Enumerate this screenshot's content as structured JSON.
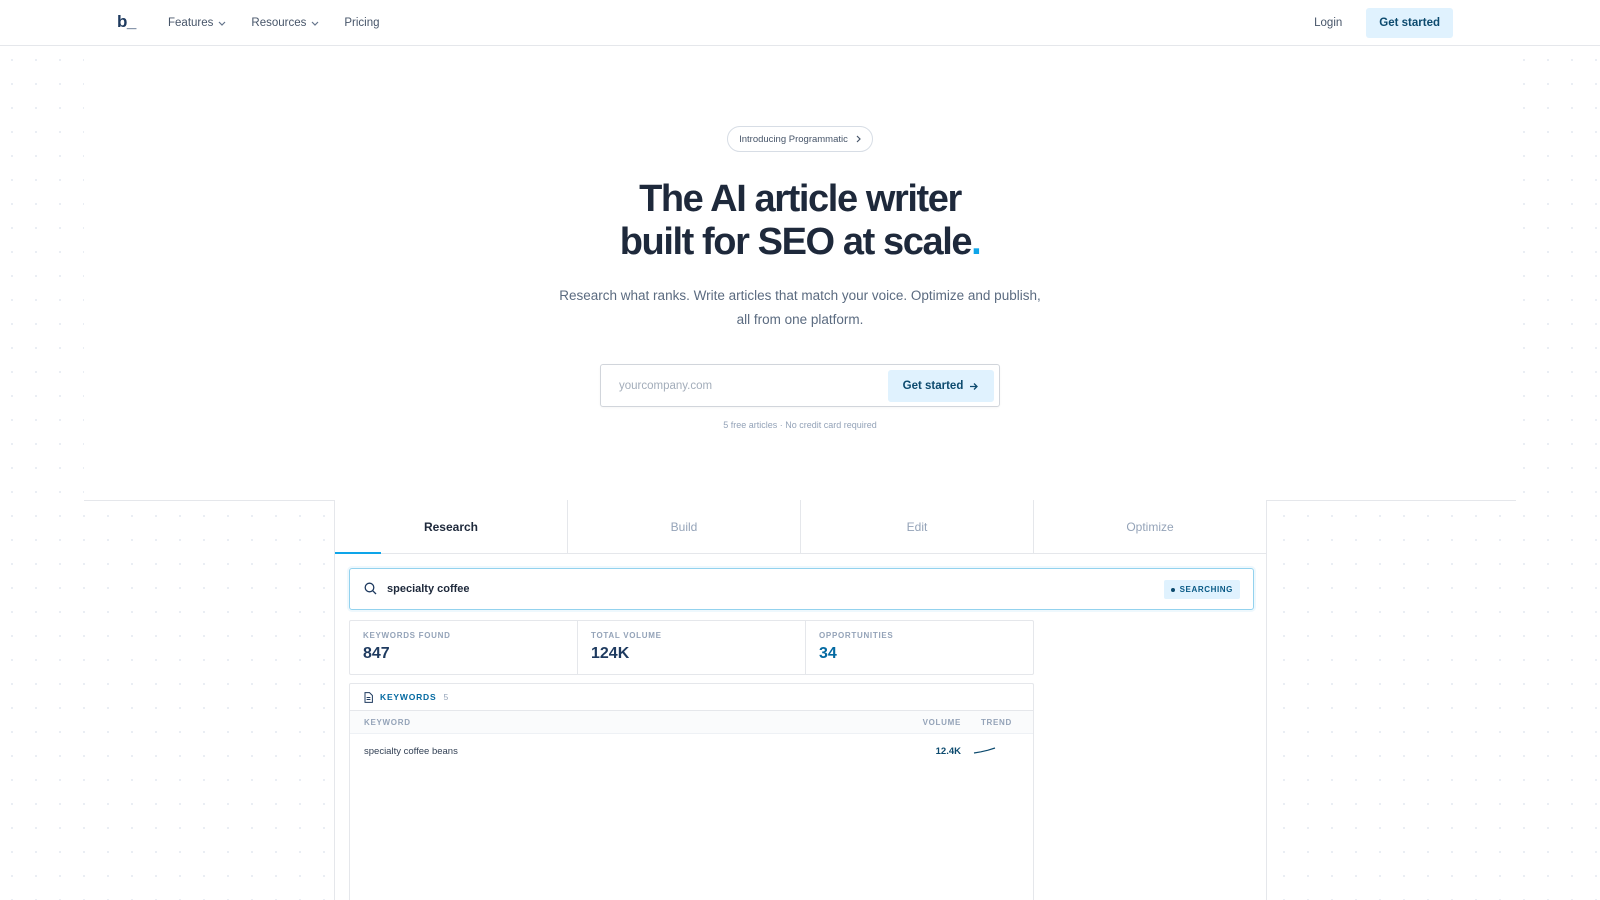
{
  "nav": {
    "logo": "b_",
    "links": [
      {
        "label": "Features",
        "has_dropdown": true
      },
      {
        "label": "Resources",
        "has_dropdown": true
      },
      {
        "label": "Pricing",
        "has_dropdown": false
      }
    ],
    "login": "Login",
    "cta": "Get started"
  },
  "hero": {
    "badge": "Introducing Programmatic",
    "headline_line1": "The AI article writer",
    "headline_line2": "built for SEO at scale",
    "headline_dot": ".",
    "subhead_line1": "Research what ranks. Write articles that match your voice. Optimize and publish,",
    "subhead_line2": "all from one platform.",
    "input_placeholder": "yourcompany.com",
    "cta": "Get started",
    "fineprint": "5 free articles · No credit card required"
  },
  "demo": {
    "tabs": [
      "Research",
      "Build",
      "Edit",
      "Optimize"
    ],
    "active_tab": "Research",
    "search_query": "specialty coffee",
    "status": "SEARCHING",
    "stats": [
      {
        "label": "KEYWORDS FOUND",
        "value": "847"
      },
      {
        "label": "TOTAL VOLUME",
        "value": "124K"
      },
      {
        "label": "OPPORTUNITIES",
        "value": "34"
      }
    ],
    "keywords": {
      "title": "KEYWORDS",
      "count": "5",
      "columns": {
        "keyword": "KEYWORD",
        "volume": "VOLUME",
        "trend": "TREND"
      },
      "rows": [
        {
          "keyword": "specialty coffee beans",
          "volume": "12.4K"
        }
      ]
    }
  },
  "colors": {
    "accent": "#0ea5e9",
    "brand_dark": "#1e3a5f",
    "button_bg": "#e0f2fe"
  }
}
